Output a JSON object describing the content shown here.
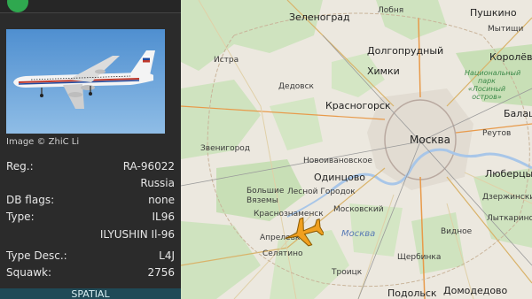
{
  "panel": {
    "photo_credit": "Image © ZhiC Li",
    "fields": [
      {
        "key": "Reg.:",
        "value": "RA-96022"
      },
      {
        "key": "",
        "value": "Russia"
      },
      {
        "key": "DB flags:",
        "value": "none"
      },
      {
        "key": "Type:",
        "value": "IL96"
      },
      {
        "key": "",
        "value": "ILYUSHIN Il-96"
      },
      {
        "key": "Type Desc.:",
        "value": "L4J"
      },
      {
        "key": "Squawk:",
        "value": "2756"
      }
    ],
    "bottom_tab": "SPATIAL"
  },
  "map": {
    "labels": {
      "zelenograd": "Зеленоград",
      "lobnya": "Лобня",
      "pushkino": "Пушкино",
      "dolgoprudny": "Долгопрудный",
      "istra": "Истра",
      "khimki": "Химки",
      "korolev": "Королёв",
      "mytishchi": "Мытищи",
      "park": "Национальный парк «Лосиный остров»",
      "dedovsk": "Дедовск",
      "krasnogorsk": "Красногорск",
      "balashikha": "Балаш",
      "moskva_city": "Москва",
      "reutov": "Реутов",
      "zvenigorod": "Звенигород",
      "novoivanovskoe": "Новоивановское",
      "lyubertsy": "Люберцы",
      "odintsovo": "Одинцово",
      "bolshie_vyazemy": "Большие Вяземы",
      "lesnoy_gorodok": "Лесной Городок",
      "dzerzhinsky": "Дзержинский",
      "krasnoznamensk": "Краснознаменск",
      "moskovsky": "Московский",
      "lytkarino": "Лыткарино",
      "aprelevka": "Апрелевка",
      "moskva_river": "Москва",
      "vidnoe": "Видное",
      "selyatino": "Селятино",
      "shcherbinka": "Щербинка",
      "troitsk": "Троицк",
      "podolsk": "Подольск",
      "domodedovo": "Домодедово"
    }
  },
  "colors": {
    "panel_bg": "#2b2b2b",
    "aircraft_icon": "#f0a020",
    "spatial_tab": "#1f4a57"
  },
  "icons": {
    "aircraft": "aircraft-icon",
    "logo": "logo-icon"
  }
}
